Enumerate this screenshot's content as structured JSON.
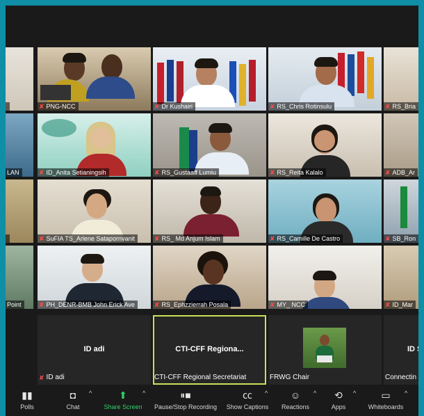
{
  "participants_row1": [
    {
      "name": ""
    },
    {
      "name": "PNG-NCC"
    },
    {
      "name": "Dr Kushairi"
    },
    {
      "name": "RS_Chris Rotinsulu"
    },
    {
      "name": "RS_Bria"
    }
  ],
  "participants_row2": [
    {
      "name": "LAN"
    },
    {
      "name": "ID_Anita Setianingsih"
    },
    {
      "name": "RS_Gustaaff Lumiu"
    },
    {
      "name": "RS_Reita Kalalo"
    },
    {
      "name": "ADB_Ar"
    }
  ],
  "participants_row3": [
    {
      "name": ""
    },
    {
      "name": "SuFIA TS_Arlene Satapornvanit"
    },
    {
      "name": "RS_ Md Anjum Islam"
    },
    {
      "name": "RS_Camille De Castro"
    },
    {
      "name": "SB_Ron"
    }
  ],
  "participants_row4": [
    {
      "name": "Point"
    },
    {
      "name": "PH_DENR-BMB John Erick Ave"
    },
    {
      "name": "RS_Ephzzierrah Posala"
    },
    {
      "name": "MY_ NCC"
    },
    {
      "name": "ID_Mar"
    }
  ],
  "bottom_tiles": [
    {
      "label": "ID adi",
      "name": "ID adi"
    },
    {
      "label": "CTI-CFF  Regiona...",
      "name": "CTI-CFF Regional Secretariat"
    },
    {
      "label": "",
      "name": "FRWG Chair"
    },
    {
      "label": "ID S",
      "name": "Connectin"
    }
  ],
  "toolbar": {
    "polls": "Polls",
    "chat": "Chat",
    "share": "Share Screen",
    "record": "Pause/Stop Recording",
    "captions": "Show Captions",
    "reactions": "Reactions",
    "apps": "Apps",
    "whiteboards": "Whiteboards"
  },
  "icons": {
    "mic": "muted-mic-icon",
    "polls": "bar-chart-icon",
    "chat": "speech-bubble-icon",
    "share": "share-arrow-icon",
    "record": "pause-stop-icon",
    "captions": "cc-icon",
    "reactions": "smiley-plus-icon",
    "apps": "apps-icon",
    "whiteboards": "whiteboard-icon"
  },
  "colors": {
    "frame": "#0f8fa6",
    "background": "#1a1a1a",
    "active_border": "#c6e25a",
    "share_green": "#2fd36b",
    "muted_red": "#ff4d4d"
  }
}
